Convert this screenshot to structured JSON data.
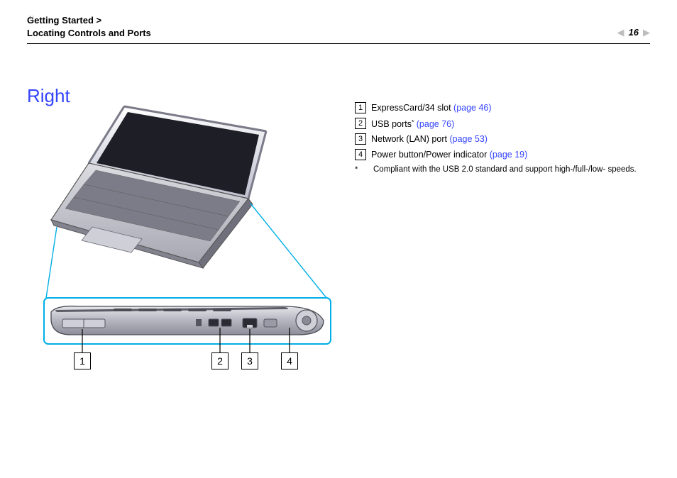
{
  "header": {
    "breadcrumb_line1": "Getting Started >",
    "breadcrumb_line2": "Locating Controls and Ports",
    "page_number": "16",
    "n_label": "N"
  },
  "title": "Right",
  "items": [
    {
      "num": "1",
      "text": "ExpressCard/34 slot ",
      "link": "(page 46)",
      "has_ast": false
    },
    {
      "num": "2",
      "text": "USB ports",
      "link": "(page 76)",
      "has_ast": true
    },
    {
      "num": "3",
      "text": "Network (LAN) port ",
      "link": "(page 53)",
      "has_ast": false
    },
    {
      "num": "4",
      "text": "Power button/Power indicator ",
      "link": "(page 19)",
      "has_ast": false
    }
  ],
  "footnote": {
    "mark": "*",
    "text": "Compliant with the USB 2.0 standard and support high-/full-/low- speeds."
  },
  "callouts": {
    "c1": "1",
    "c2": "2",
    "c3": "3",
    "c4": "4"
  }
}
